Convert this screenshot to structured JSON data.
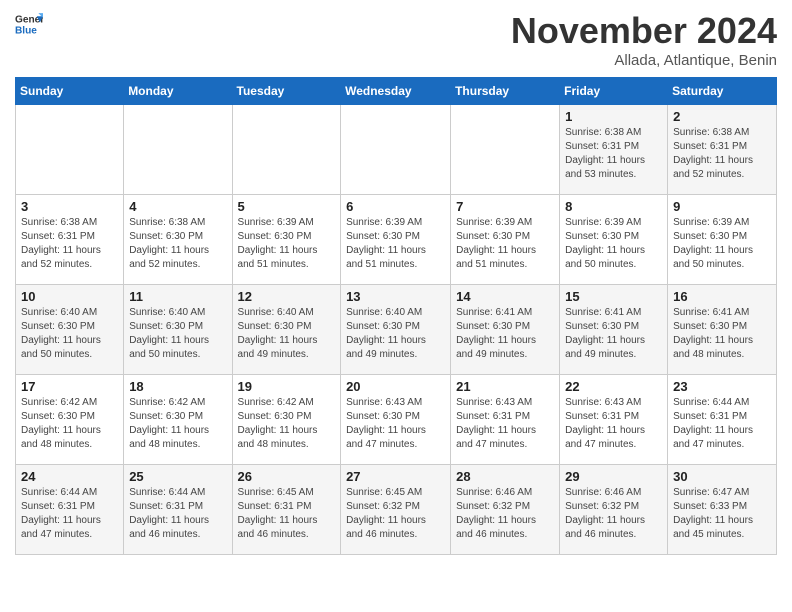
{
  "header": {
    "logo_general": "General",
    "logo_blue": "Blue",
    "month_title": "November 2024",
    "location": "Allada, Atlantique, Benin"
  },
  "weekdays": [
    "Sunday",
    "Monday",
    "Tuesday",
    "Wednesday",
    "Thursday",
    "Friday",
    "Saturday"
  ],
  "weeks": [
    [
      {
        "day": "",
        "info": ""
      },
      {
        "day": "",
        "info": ""
      },
      {
        "day": "",
        "info": ""
      },
      {
        "day": "",
        "info": ""
      },
      {
        "day": "",
        "info": ""
      },
      {
        "day": "1",
        "info": "Sunrise: 6:38 AM\nSunset: 6:31 PM\nDaylight: 11 hours and 53 minutes."
      },
      {
        "day": "2",
        "info": "Sunrise: 6:38 AM\nSunset: 6:31 PM\nDaylight: 11 hours and 52 minutes."
      }
    ],
    [
      {
        "day": "3",
        "info": "Sunrise: 6:38 AM\nSunset: 6:31 PM\nDaylight: 11 hours and 52 minutes."
      },
      {
        "day": "4",
        "info": "Sunrise: 6:38 AM\nSunset: 6:30 PM\nDaylight: 11 hours and 52 minutes."
      },
      {
        "day": "5",
        "info": "Sunrise: 6:39 AM\nSunset: 6:30 PM\nDaylight: 11 hours and 51 minutes."
      },
      {
        "day": "6",
        "info": "Sunrise: 6:39 AM\nSunset: 6:30 PM\nDaylight: 11 hours and 51 minutes."
      },
      {
        "day": "7",
        "info": "Sunrise: 6:39 AM\nSunset: 6:30 PM\nDaylight: 11 hours and 51 minutes."
      },
      {
        "day": "8",
        "info": "Sunrise: 6:39 AM\nSunset: 6:30 PM\nDaylight: 11 hours and 50 minutes."
      },
      {
        "day": "9",
        "info": "Sunrise: 6:39 AM\nSunset: 6:30 PM\nDaylight: 11 hours and 50 minutes."
      }
    ],
    [
      {
        "day": "10",
        "info": "Sunrise: 6:40 AM\nSunset: 6:30 PM\nDaylight: 11 hours and 50 minutes."
      },
      {
        "day": "11",
        "info": "Sunrise: 6:40 AM\nSunset: 6:30 PM\nDaylight: 11 hours and 50 minutes."
      },
      {
        "day": "12",
        "info": "Sunrise: 6:40 AM\nSunset: 6:30 PM\nDaylight: 11 hours and 49 minutes."
      },
      {
        "day": "13",
        "info": "Sunrise: 6:40 AM\nSunset: 6:30 PM\nDaylight: 11 hours and 49 minutes."
      },
      {
        "day": "14",
        "info": "Sunrise: 6:41 AM\nSunset: 6:30 PM\nDaylight: 11 hours and 49 minutes."
      },
      {
        "day": "15",
        "info": "Sunrise: 6:41 AM\nSunset: 6:30 PM\nDaylight: 11 hours and 49 minutes."
      },
      {
        "day": "16",
        "info": "Sunrise: 6:41 AM\nSunset: 6:30 PM\nDaylight: 11 hours and 48 minutes."
      }
    ],
    [
      {
        "day": "17",
        "info": "Sunrise: 6:42 AM\nSunset: 6:30 PM\nDaylight: 11 hours and 48 minutes."
      },
      {
        "day": "18",
        "info": "Sunrise: 6:42 AM\nSunset: 6:30 PM\nDaylight: 11 hours and 48 minutes."
      },
      {
        "day": "19",
        "info": "Sunrise: 6:42 AM\nSunset: 6:30 PM\nDaylight: 11 hours and 48 minutes."
      },
      {
        "day": "20",
        "info": "Sunrise: 6:43 AM\nSunset: 6:30 PM\nDaylight: 11 hours and 47 minutes."
      },
      {
        "day": "21",
        "info": "Sunrise: 6:43 AM\nSunset: 6:31 PM\nDaylight: 11 hours and 47 minutes."
      },
      {
        "day": "22",
        "info": "Sunrise: 6:43 AM\nSunset: 6:31 PM\nDaylight: 11 hours and 47 minutes."
      },
      {
        "day": "23",
        "info": "Sunrise: 6:44 AM\nSunset: 6:31 PM\nDaylight: 11 hours and 47 minutes."
      }
    ],
    [
      {
        "day": "24",
        "info": "Sunrise: 6:44 AM\nSunset: 6:31 PM\nDaylight: 11 hours and 47 minutes."
      },
      {
        "day": "25",
        "info": "Sunrise: 6:44 AM\nSunset: 6:31 PM\nDaylight: 11 hours and 46 minutes."
      },
      {
        "day": "26",
        "info": "Sunrise: 6:45 AM\nSunset: 6:31 PM\nDaylight: 11 hours and 46 minutes."
      },
      {
        "day": "27",
        "info": "Sunrise: 6:45 AM\nSunset: 6:32 PM\nDaylight: 11 hours and 46 minutes."
      },
      {
        "day": "28",
        "info": "Sunrise: 6:46 AM\nSunset: 6:32 PM\nDaylight: 11 hours and 46 minutes."
      },
      {
        "day": "29",
        "info": "Sunrise: 6:46 AM\nSunset: 6:32 PM\nDaylight: 11 hours and 46 minutes."
      },
      {
        "day": "30",
        "info": "Sunrise: 6:47 AM\nSunset: 6:33 PM\nDaylight: 11 hours and 45 minutes."
      }
    ]
  ]
}
